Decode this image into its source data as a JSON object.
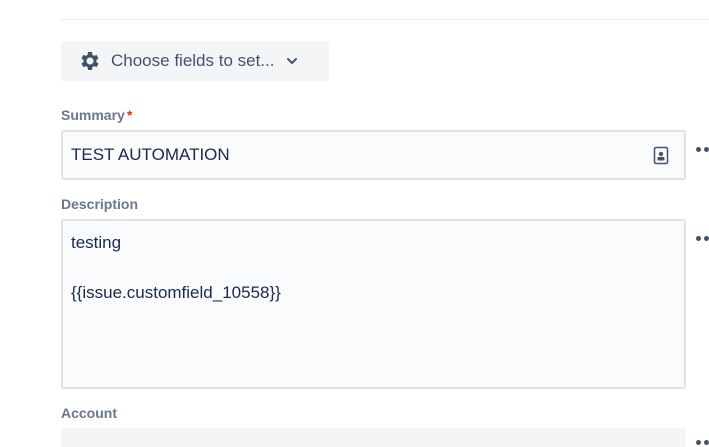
{
  "choose_fields": {
    "label": "Choose fields to set...",
    "icon": "gear-icon",
    "chevron": "chevron-down-icon"
  },
  "fields": {
    "summary": {
      "label": "Summary",
      "required_mark": "*",
      "value": "TEST AUTOMATION",
      "icon": "smart-value-icon"
    },
    "description": {
      "label": "Description",
      "lines": [
        "testing",
        "{{issue.customfield_10558}}"
      ]
    },
    "account": {
      "label": "Account"
    }
  },
  "colors": {
    "label": "#6b778c",
    "required": "#de350b",
    "text": "#172b4d",
    "button_bg": "#f4f5f7",
    "input_bg": "#fafbfc",
    "input_border": "#dfe1e6"
  }
}
